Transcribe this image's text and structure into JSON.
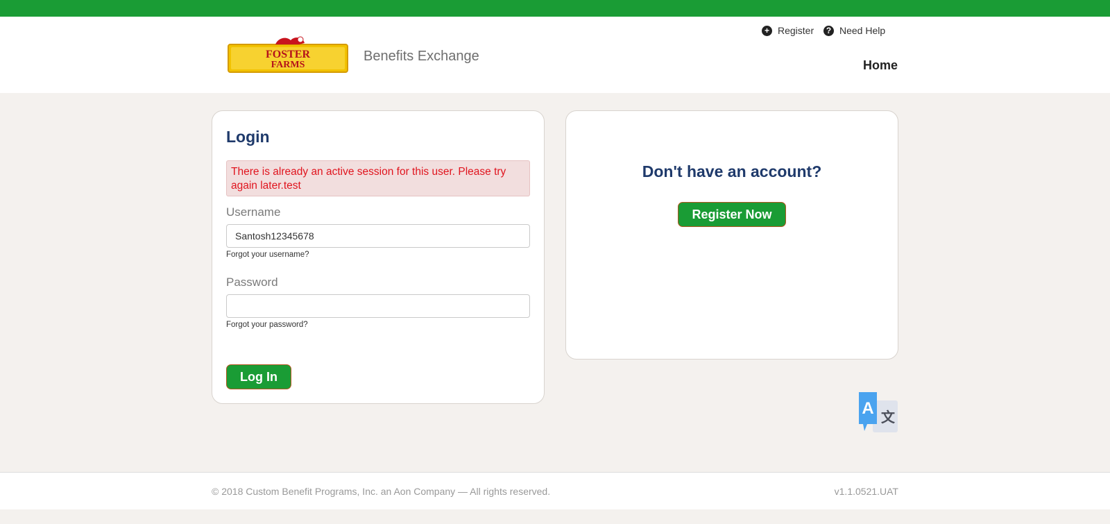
{
  "header": {
    "brand_title": "Benefits Exchange",
    "logo_text_line1": "FOSTER",
    "logo_text_line2": "FARMS",
    "links": {
      "register": "Register",
      "need_help": "Need Help"
    },
    "nav": {
      "home": "Home"
    }
  },
  "login": {
    "title": "Login",
    "error_message": "There is already an active session for this user. Please try again later.test",
    "username_label": "Username",
    "username_value": "Santosh12345678",
    "forgot_username": "Forgot your username?",
    "password_label": "Password",
    "password_value": "",
    "forgot_password": "Forgot your password?",
    "login_button": "Log In"
  },
  "signup": {
    "heading": "Don't have an account?",
    "register_button": "Register Now"
  },
  "footer": {
    "copyright": "© 2018 Custom Benefit Programs, Inc. an Aon Company — All rights reserved.",
    "version": "v1.1.0521.UAT"
  },
  "icons": {
    "register": "plus-circle-icon",
    "help": "question-circle-icon",
    "translate": "translate-icon"
  },
  "colors": {
    "brand_green": "#1a9c35",
    "heading_navy": "#1f3a6b",
    "error_red": "#e0141e",
    "page_background": "#f4f1ee"
  }
}
